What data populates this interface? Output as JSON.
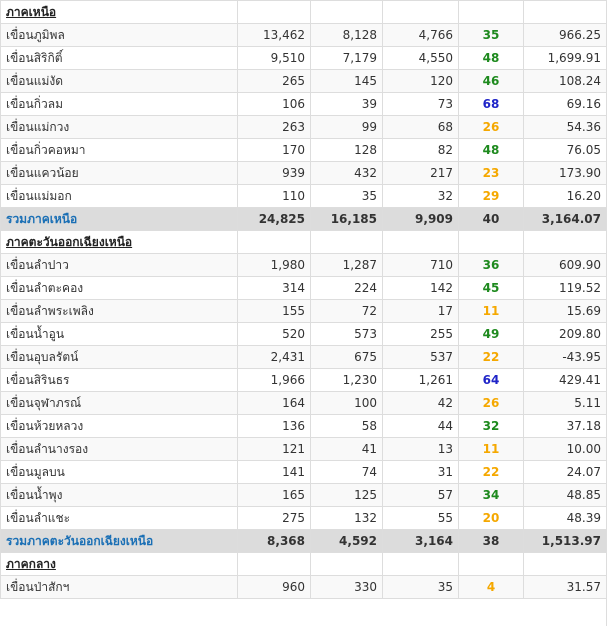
{
  "colors": {
    "green": "#1e8a1e",
    "orange": "#f5a800",
    "blue": "#1f24c8",
    "total_label": "#1a6fb5",
    "total_bg": "#dcdcdc"
  },
  "rows": [
    {
      "kind": "section",
      "name": "ภาคเหนือ"
    },
    {
      "kind": "dam",
      "name": "เขื่อนภูมิพล",
      "v1": "13,462",
      "v2": "8,128",
      "v3": "4,766",
      "pct": "35",
      "level": "green",
      "v5": "966.25"
    },
    {
      "kind": "dam",
      "name": "เขื่อนสิริกิติ์",
      "v1": "9,510",
      "v2": "7,179",
      "v3": "4,550",
      "pct": "48",
      "level": "green",
      "v5": "1,699.91"
    },
    {
      "kind": "dam",
      "name": "เขื่อนแม่งัด",
      "v1": "265",
      "v2": "145",
      "v3": "120",
      "pct": "46",
      "level": "green",
      "v5": "108.24"
    },
    {
      "kind": "dam",
      "name": "เขื่อนกิ่วลม",
      "v1": "106",
      "v2": "39",
      "v3": "73",
      "pct": "68",
      "level": "blue",
      "v5": "69.16"
    },
    {
      "kind": "dam",
      "name": "เขื่อนแม่กวง",
      "v1": "263",
      "v2": "99",
      "v3": "68",
      "pct": "26",
      "level": "orange",
      "v5": "54.36"
    },
    {
      "kind": "dam",
      "name": "เขื่อนกิ่วคอหมา",
      "v1": "170",
      "v2": "128",
      "v3": "82",
      "pct": "48",
      "level": "green",
      "v5": "76.05"
    },
    {
      "kind": "dam",
      "name": "เขื่อนแควน้อย",
      "v1": "939",
      "v2": "432",
      "v3": "217",
      "pct": "23",
      "level": "orange",
      "v5": "173.90"
    },
    {
      "kind": "dam",
      "name": "เขื่อนแม่มอก",
      "v1": "110",
      "v2": "35",
      "v3": "32",
      "pct": "29",
      "level": "orange",
      "v5": "16.20"
    },
    {
      "kind": "total",
      "name": "รวมภาคเหนือ",
      "v1": "24,825",
      "v2": "16,185",
      "v3": "9,909",
      "pct": "40",
      "level": "plain",
      "v5": "3,164.07"
    },
    {
      "kind": "section",
      "name": "ภาคตะวันออกเฉียงเหนือ"
    },
    {
      "kind": "dam",
      "name": "เขื่อนลำปาว",
      "v1": "1,980",
      "v2": "1,287",
      "v3": "710",
      "pct": "36",
      "level": "green",
      "v5": "609.90"
    },
    {
      "kind": "dam",
      "name": "เขื่อนลำตะคอง",
      "v1": "314",
      "v2": "224",
      "v3": "142",
      "pct": "45",
      "level": "green",
      "v5": "119.52"
    },
    {
      "kind": "dam",
      "name": "เขื่อนลำพระเพลิง",
      "v1": "155",
      "v2": "72",
      "v3": "17",
      "pct": "11",
      "level": "orange",
      "v5": "15.69"
    },
    {
      "kind": "dam",
      "name": "เขื่อนน้ำอูน",
      "v1": "520",
      "v2": "573",
      "v3": "255",
      "pct": "49",
      "level": "green",
      "v5": "209.80"
    },
    {
      "kind": "dam",
      "name": "เขื่อนอุบลรัตน์",
      "v1": "2,431",
      "v2": "675",
      "v3": "537",
      "pct": "22",
      "level": "orange",
      "v5": "-43.95"
    },
    {
      "kind": "dam",
      "name": "เขื่อนสิรินธร",
      "v1": "1,966",
      "v2": "1,230",
      "v3": "1,261",
      "pct": "64",
      "level": "blue",
      "v5": "429.41"
    },
    {
      "kind": "dam",
      "name": "เขื่อนจุฬาภรณ์",
      "v1": "164",
      "v2": "100",
      "v3": "42",
      "pct": "26",
      "level": "orange",
      "v5": "5.11"
    },
    {
      "kind": "dam",
      "name": "เขื่อนห้วยหลวง",
      "v1": "136",
      "v2": "58",
      "v3": "44",
      "pct": "32",
      "level": "green",
      "v5": "37.18"
    },
    {
      "kind": "dam",
      "name": "เขื่อนลำนางรอง",
      "v1": "121",
      "v2": "41",
      "v3": "13",
      "pct": "11",
      "level": "orange",
      "v5": "10.00"
    },
    {
      "kind": "dam",
      "name": "เขื่อนมูลบน",
      "v1": "141",
      "v2": "74",
      "v3": "31",
      "pct": "22",
      "level": "orange",
      "v5": "24.07"
    },
    {
      "kind": "dam",
      "name": "เขื่อนน้ำพุง",
      "v1": "165",
      "v2": "125",
      "v3": "57",
      "pct": "34",
      "level": "green",
      "v5": "48.85"
    },
    {
      "kind": "dam",
      "name": "เขื่อนลำแชะ",
      "v1": "275",
      "v2": "132",
      "v3": "55",
      "pct": "20",
      "level": "orange",
      "v5": "48.39"
    },
    {
      "kind": "total",
      "name": "รวมภาคตะวันออกเฉียงเหนือ",
      "v1": "8,368",
      "v2": "4,592",
      "v3": "3,164",
      "pct": "38",
      "level": "plain",
      "v5": "1,513.97"
    },
    {
      "kind": "section",
      "name": "ภาคกลาง"
    },
    {
      "kind": "dam",
      "name": "เขื่อนป่าสักฯ",
      "v1": "960",
      "v2": "330",
      "v3": "35",
      "pct": "4",
      "level": "orange",
      "v5": "31.57"
    }
  ]
}
